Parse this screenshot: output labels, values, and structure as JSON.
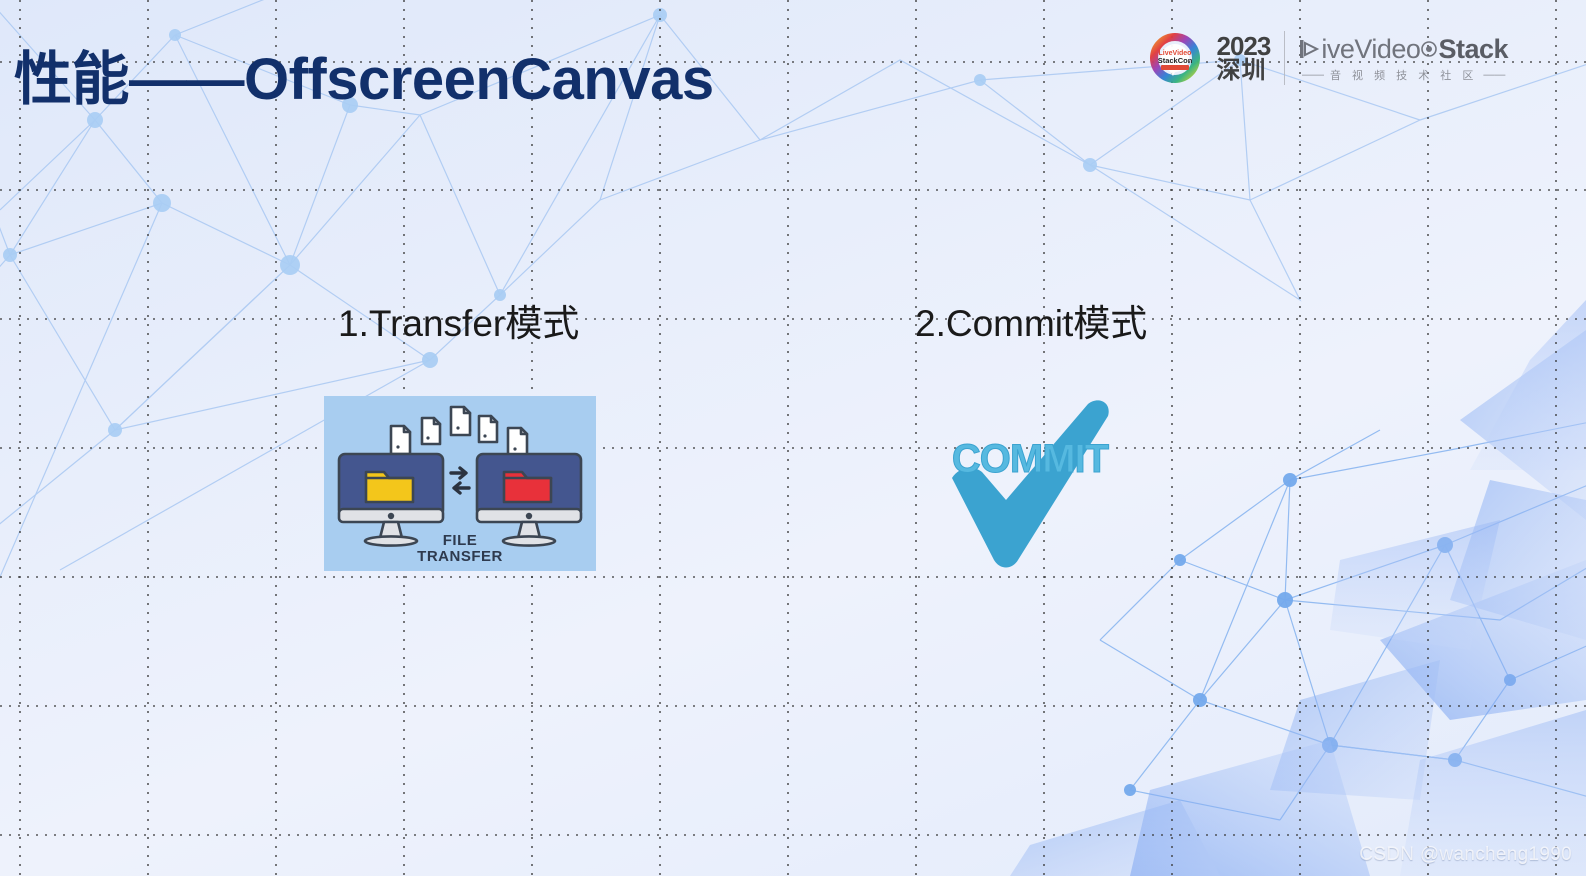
{
  "slide": {
    "title": "性能——OffscreenCanvas",
    "title_color": "#12306b",
    "background_color": "#e7edfb"
  },
  "logo": {
    "ring_icon": "livevideostackcon-ring-icon",
    "year": "2023",
    "city": "深圳",
    "brand_live": "ive",
    "brand_video": "Video",
    "brand_stack": "Stack",
    "brand_tagline": "音 视 频 技 术 社 区",
    "tagline_dash_left": "——",
    "tagline_dash_right": "——"
  },
  "columns": [
    {
      "id": "transfer",
      "label": "1.Transfer模式",
      "illustration": {
        "name": "file-transfer-illustration",
        "panel_color": "#a8cdf0",
        "caption_line1": "FILE",
        "caption_line2": "TRANSFER",
        "left_folder_color": "#f3c61b",
        "right_folder_color": "#e8313a",
        "screen_color": "#44568f",
        "outline_color": "#3c4653"
      }
    },
    {
      "id": "commit",
      "label": "2.Commit模式",
      "illustration": {
        "name": "commit-checkmark-illustration",
        "word": "COMMIT",
        "check_color": "#3ba3d0",
        "word_color": "#56b9e0"
      }
    }
  ],
  "watermark": {
    "text": "CSDN @wancheng1990"
  }
}
